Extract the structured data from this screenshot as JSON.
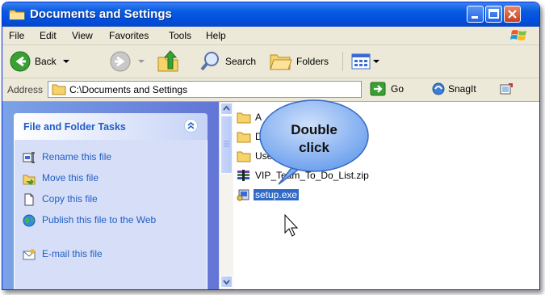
{
  "window": {
    "title": "Documents and Settings"
  },
  "menu": [
    "File",
    "Edit",
    "View",
    "Favorites",
    "Tools",
    "Help"
  ],
  "toolbar": {
    "back": "Back",
    "search": "Search",
    "folders": "Folders"
  },
  "address": {
    "label": "Address",
    "path": "C:\\Documents and Settings",
    "go": "Go",
    "snagit": "SnagIt"
  },
  "tasks": {
    "header": "File and Folder Tasks",
    "items": [
      "Rename this file",
      "Move this file",
      "Copy this file",
      "Publish this file to the Web",
      "E-mail this file"
    ]
  },
  "files": {
    "items": [
      "A",
      "D",
      "User2",
      "VIP_Team_To_Do_List.zip",
      "setup.exe"
    ]
  },
  "callout": {
    "line1": "Double",
    "line2": "click"
  },
  "colors": {
    "title_bar": "#0a5ce0",
    "task_link": "#215dc6",
    "selection": "#316ac5",
    "callout": "#6ea1ee"
  }
}
